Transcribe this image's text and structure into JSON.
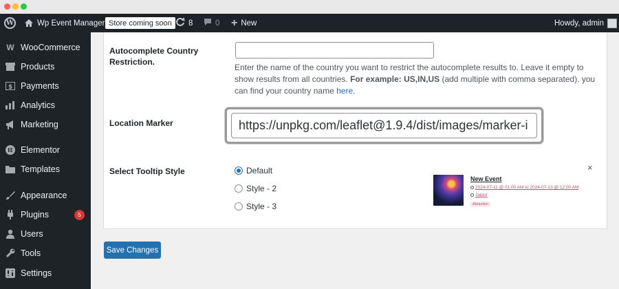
{
  "window": {
    "controls": [
      "close",
      "minimize",
      "maximize"
    ]
  },
  "adminbar": {
    "site_name": "Wp Event Manager",
    "store_badge": "Store coming soon",
    "updates_count": "8",
    "comments_count": "0",
    "new_label": "New",
    "howdy": "Howdy, admin"
  },
  "sidebar": {
    "items": [
      {
        "label": "WooCommerce",
        "icon": "woo-icon"
      },
      {
        "label": "Products",
        "icon": "products-icon"
      },
      {
        "label": "Payments",
        "icon": "payments-icon"
      },
      {
        "label": "Analytics",
        "icon": "analytics-icon"
      },
      {
        "label": "Marketing",
        "icon": "megaphone-icon"
      },
      {
        "label": "Elementor",
        "icon": "elementor-icon"
      },
      {
        "label": "Templates",
        "icon": "folder-icon"
      },
      {
        "label": "Appearance",
        "icon": "brush-icon"
      },
      {
        "label": "Plugins",
        "icon": "plugin-icon",
        "badge": "5"
      },
      {
        "label": "Users",
        "icon": "user-icon"
      },
      {
        "label": "Tools",
        "icon": "wrench-icon"
      },
      {
        "label": "Settings",
        "icon": "settings-icon"
      }
    ]
  },
  "form": {
    "autocomplete": {
      "label_line1": "Autocomplete Country",
      "label_line2": "Restriction.",
      "value": "",
      "desc_part1": "Enter the name of the country you want to restrict the autocomplete results to. Leave it empty to show results from all countries.",
      "desc_example_label": "For example: US,IN,US",
      "desc_part2": "(add multiple with comma separated). you can find your country name",
      "desc_link": "here"
    },
    "location_marker": {
      "label": "Location Marker",
      "value": "https://unpkg.com/leaflet@1.9.4/dist/images/marker-i"
    },
    "tooltip_style": {
      "label": "Select Tooltip Style",
      "options": [
        "Default",
        "Style - 2",
        "Style - 3"
      ],
      "selected": "Default"
    },
    "preview": {
      "title": "New Event",
      "date": "2024-07-11 @ 01:00 AM to 2024-07-13 @ 12:00 AM",
      "location": "Jaipur",
      "tag": "Attraction",
      "close": "×"
    },
    "save_label": "Save Changes"
  },
  "colors": {
    "accent": "#2271b1",
    "adminbar": "#1d2327",
    "badge": "#d63638"
  }
}
